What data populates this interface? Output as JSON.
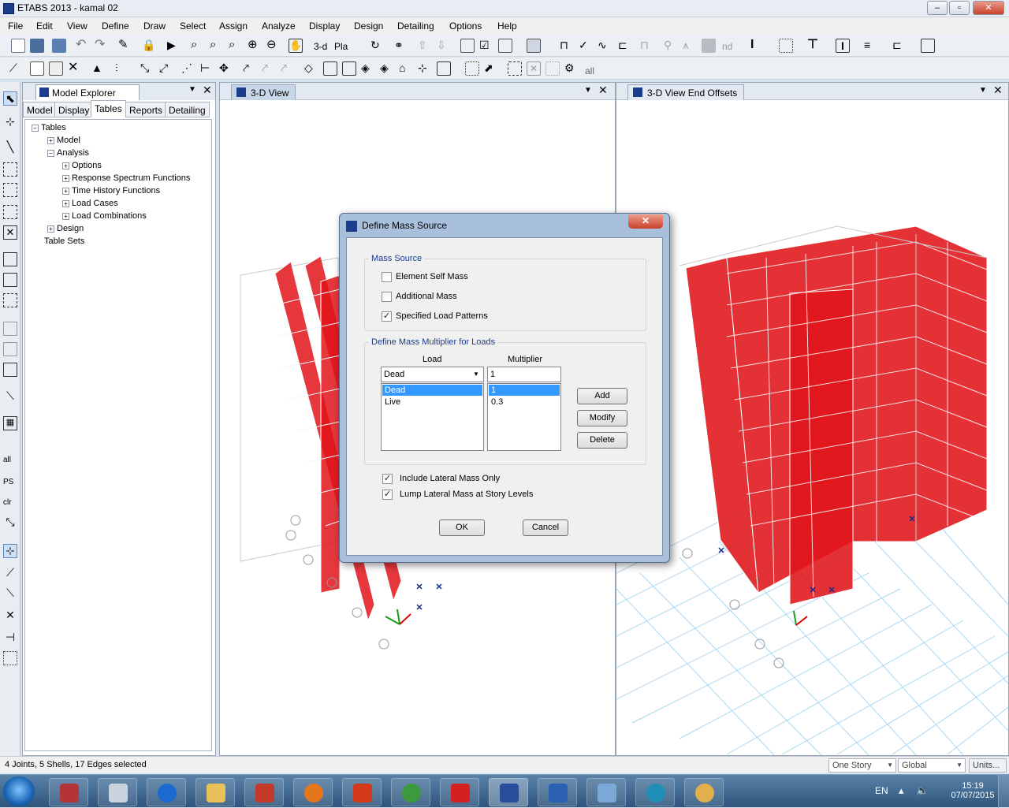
{
  "window": {
    "title": "ETABS 2013  - kamal 02",
    "min": "–",
    "restore": "▫",
    "close": "✕"
  },
  "menu": [
    "File",
    "Edit",
    "View",
    "Define",
    "Draw",
    "Select",
    "Assign",
    "Analyze",
    "Display",
    "Design",
    "Detailing",
    "Options",
    "Help"
  ],
  "toolbar": {
    "view3d_label": "3-d",
    "plan_label": "Pla",
    "nd_label": "nd",
    "all_label": "all"
  },
  "left_tools": {
    "all_label": "all",
    "ps_label": "PS",
    "clr_label": "clr"
  },
  "explorer": {
    "title": "Model Explorer",
    "tabs": [
      "Model",
      "Display",
      "Tables",
      "Reports",
      "Detailing"
    ],
    "active_tab": "Tables",
    "tree": {
      "root": "Tables",
      "model": "Model",
      "analysis": "Analysis",
      "options": "Options",
      "rsf": "Response Spectrum Functions",
      "thf": "Time History Functions",
      "load_cases": "Load Cases",
      "load_combos": "Load Combinations",
      "design": "Design",
      "table_sets": "Table Sets"
    }
  },
  "views": {
    "left_title": "3-D View",
    "right_title": "3-D View  End Offsets"
  },
  "dialog": {
    "title": "Define Mass Source",
    "close": "✕",
    "mass_source_label": "Mass Source",
    "element_self_mass": "Element Self Mass",
    "element_self_mass_checked": false,
    "additional_mass": "Additional Mass",
    "additional_mass_checked": false,
    "specified_load_patterns": "Specified Load Patterns",
    "specified_load_patterns_checked": true,
    "multiplier_group_label": "Define Mass Multiplier for Loads",
    "load_header": "Load",
    "multiplier_header": "Multiplier",
    "load_select_value": "Dead",
    "multiplier_input_value": "1",
    "loads": [
      "Dead",
      "Live"
    ],
    "multipliers": [
      "1",
      "0.3"
    ],
    "selected_index": 0,
    "add": "Add",
    "modify": "Modify",
    "delete": "Delete",
    "include_lateral": "Include Lateral Mass Only",
    "include_lateral_checked": true,
    "lump_lateral": "Lump Lateral Mass at Story Levels",
    "lump_lateral_checked": true,
    "ok": "OK",
    "cancel": "Cancel"
  },
  "status": {
    "text": "4 Joints, 5 Shells, 17 Edges selected",
    "story": "One Story",
    "coord": "Global",
    "units": "Units..."
  },
  "taskbar": {
    "lang": "EN",
    "time": "15:19",
    "date": "07/07/2015"
  },
  "colors": {
    "shell_red": "#e0141a",
    "grid_blue": "#9ed4f2",
    "accent": "#3399ff"
  }
}
